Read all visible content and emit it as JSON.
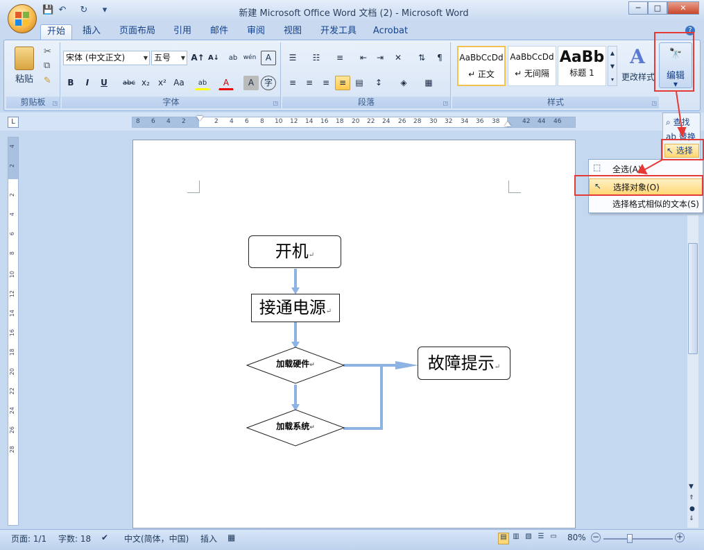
{
  "window": {
    "title": "新建 Microsoft Office Word 文档 (2) - Microsoft Word",
    "minimize": "─",
    "maximize": "□",
    "close": "✕"
  },
  "qat": {
    "save": "💾",
    "undo": "↶",
    "redo": "↻",
    "customize": "▾"
  },
  "tabs": [
    "开始",
    "插入",
    "页面布局",
    "引用",
    "邮件",
    "审阅",
    "视图",
    "开发工具",
    "Acrobat"
  ],
  "clipboard": {
    "paste": "粘贴",
    "label": "剪贴板"
  },
  "font": {
    "name": "宋体 (中文正文)",
    "size": "五号",
    "label": "字体",
    "grow": "A↑",
    "shrink": "A↓",
    "clear": "ab",
    "phonetic": "wén",
    "border": "A",
    "bold": "B",
    "italic": "I",
    "underline": "U",
    "strike": "abc",
    "sub": "x₂",
    "sup": "x²",
    "case": "Aa",
    "highlight": "ab",
    "color": "A",
    "shade": "A",
    "enclose": "字"
  },
  "paragraph": {
    "label": "段落"
  },
  "styles": {
    "label": "样式",
    "items": [
      {
        "sample": "AaBbCcDd",
        "name": "↵ 正文"
      },
      {
        "sample": "AaBbCcDd",
        "name": "↵ 无间隔"
      },
      {
        "sample": "AaBb",
        "name": "标题 1"
      }
    ],
    "change": "更改样式"
  },
  "editing": {
    "label": "编辑",
    "find": "查找",
    "replace": "替换",
    "select": "选择"
  },
  "select_menu": {
    "items": [
      "全选(A)",
      "选择对象(O)",
      "选择格式相似的文本(S)"
    ]
  },
  "ruler": {
    "h": [
      "8",
      "6",
      "4",
      "2",
      "2",
      "4",
      "6",
      "8",
      "10",
      "12",
      "14",
      "16",
      "18",
      "20",
      "22",
      "24",
      "26",
      "28",
      "30",
      "32",
      "34",
      "36",
      "38",
      "42",
      "44",
      "46",
      "48"
    ],
    "v": [
      "4",
      "2",
      "2",
      "4",
      "6",
      "8",
      "10",
      "12",
      "14",
      "16",
      "18",
      "20",
      "22",
      "24",
      "26",
      "28"
    ]
  },
  "flow": {
    "start": "开机",
    "power": "接通电源",
    "hw": "加载硬件",
    "sys": "加载系统",
    "fault": "故障提示",
    "mark": "↵"
  },
  "status": {
    "page": "页面: 1/1",
    "words": "字数: 18",
    "lang": "中文(简体，中国)",
    "mode": "插入",
    "zoom": "80%"
  },
  "colors": {
    "accent": "#15428b",
    "arrow": "#8db3e2",
    "highlight": "#ffd774",
    "red": "#e53935"
  }
}
